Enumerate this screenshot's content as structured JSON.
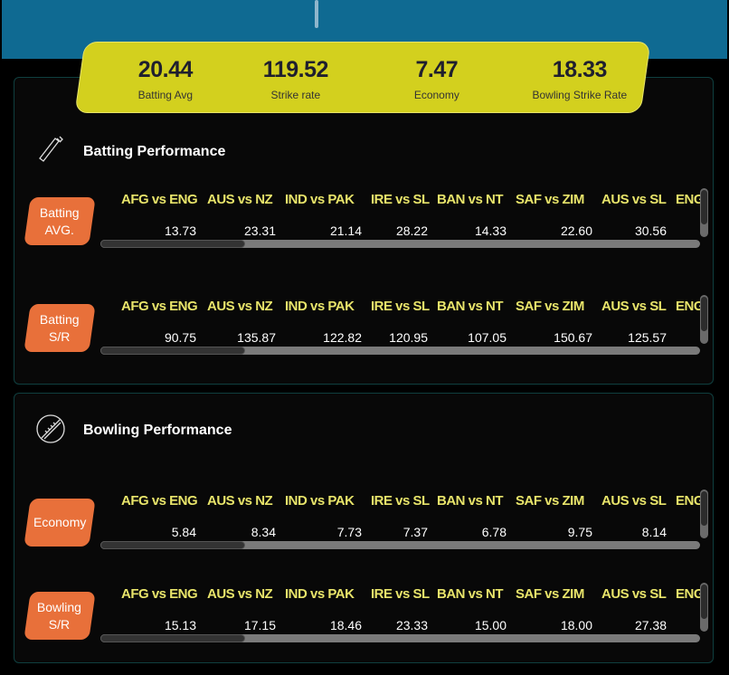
{
  "summary": [
    {
      "value": "20.44",
      "label": "Batting Avg"
    },
    {
      "value": "119.52",
      "label": "Strike rate"
    },
    {
      "value": "7.47",
      "label": "Economy"
    },
    {
      "value": "18.33",
      "label": "Bowling Strike Rate"
    }
  ],
  "matches": [
    "AFG vs ENG",
    "AUS vs NZ",
    "IND vs PAK",
    "IRE vs SL",
    "BAN vs NT",
    "SAF vs ZIM",
    "AUS vs SL",
    "ENG"
  ],
  "batting": {
    "title": "Batting Performance",
    "rows": [
      {
        "label": "Batting\nAVG.",
        "values": [
          "13.73",
          "23.31",
          "21.14",
          "28.22",
          "14.33",
          "22.60",
          "30.56",
          ""
        ]
      },
      {
        "label": "Batting\nS/R",
        "values": [
          "90.75",
          "135.87",
          "122.82",
          "120.95",
          "107.05",
          "150.67",
          "125.57",
          ""
        ]
      }
    ]
  },
  "bowling": {
    "title": "Bowling Performance",
    "rows": [
      {
        "label": "Economy",
        "values": [
          "5.84",
          "8.34",
          "7.73",
          "7.37",
          "6.78",
          "9.75",
          "8.14",
          ""
        ]
      },
      {
        "label": "Bowling\nS/R",
        "values": [
          "15.13",
          "17.15",
          "18.46",
          "23.33",
          "15.00",
          "18.00",
          "27.38",
          ""
        ]
      }
    ]
  },
  "colors": {
    "header": "#0f6a92",
    "summary": "#d3d01e",
    "tag": "#e8703a",
    "match": "#e8e46a"
  }
}
